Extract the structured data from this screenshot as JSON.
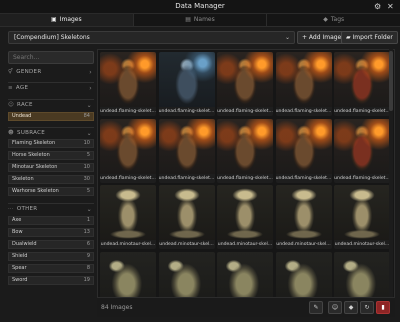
{
  "window": {
    "title": "Data Manager",
    "icons": [
      "gear-icon",
      "close-icon"
    ]
  },
  "tabs": [
    {
      "label": "Images",
      "icon": "images-icon",
      "active": true
    },
    {
      "label": "Names",
      "icon": "names-icon",
      "active": false
    },
    {
      "label": "Tags",
      "icon": "tags-icon",
      "active": false
    }
  ],
  "toolbar": {
    "collection_value": "[Compendium] Skeletons",
    "add_image_label": "+ Add Image",
    "import_folder_label": "Import Folder"
  },
  "sidebar": {
    "search_placeholder": "Search...",
    "sections": {
      "gender": "GENDER",
      "age": "AGE",
      "race": "RACE",
      "subrace": "SUBRACE",
      "other": "OTHER"
    },
    "race_items": [
      {
        "label": "Undead",
        "count": "84",
        "selected": true
      }
    ],
    "subrace_items": [
      {
        "label": "Flaming Skeleton",
        "count": "10"
      },
      {
        "label": "Horse Skeleton",
        "count": "5"
      },
      {
        "label": "Minotaur Skeleton",
        "count": "10"
      },
      {
        "label": "Skeleton",
        "count": "30"
      },
      {
        "label": "Warhorse Skeleton",
        "count": "5"
      }
    ],
    "other_items": [
      {
        "label": "Axe",
        "count": "1"
      },
      {
        "label": "Bow",
        "count": "13"
      },
      {
        "label": "Dualwield",
        "count": "6"
      },
      {
        "label": "Shield",
        "count": "9"
      },
      {
        "label": "Spear",
        "count": "8"
      },
      {
        "label": "Sword",
        "count": "19"
      }
    ]
  },
  "grid": {
    "captions": [
      "undead.flaming-skelet...",
      "undead.flaming-skelet...",
      "undead.flaming-skelet...",
      "undead.flaming-skelet...",
      "undead.flaming-skelet...",
      "undead.flaming-skelet...",
      "undead.flaming-skelet...",
      "undead.flaming-skelet...",
      "undead.flaming-skelet...",
      "undead.flaming-skelet...",
      "undead.minotaur-skel...",
      "undead.minotaur-skel...",
      "undead.minotaur-skel...",
      "undead.minotaur-skel...",
      "undead.minotaur-skel...",
      "",
      "",
      "",
      "",
      ""
    ]
  },
  "status": {
    "count_label": "84 Images",
    "buttons": [
      "pencil-icon",
      "user-add-icon",
      "tag-icon",
      "refresh-icon",
      "trash-icon"
    ]
  },
  "colors": {
    "accent": "#4a3a22",
    "danger": "#8e2525"
  }
}
